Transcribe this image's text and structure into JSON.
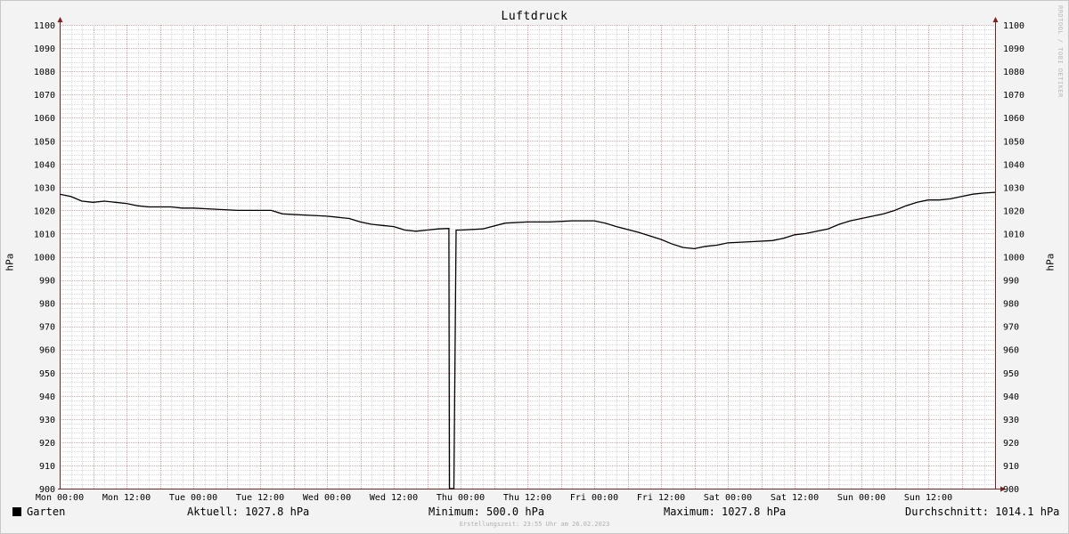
{
  "chart_data": {
    "type": "line",
    "title": "Luftdruck",
    "ylabel": "hPa",
    "ylim": [
      900,
      1100
    ],
    "yticks": [
      900,
      910,
      920,
      930,
      940,
      950,
      960,
      970,
      980,
      990,
      1000,
      1010,
      1020,
      1030,
      1040,
      1050,
      1060,
      1070,
      1080,
      1090,
      1100
    ],
    "xlim": [
      0,
      168
    ],
    "xticks": [
      {
        "x": 0,
        "label": "Mon 00:00"
      },
      {
        "x": 12,
        "label": "Mon 12:00"
      },
      {
        "x": 24,
        "label": "Tue 00:00"
      },
      {
        "x": 36,
        "label": "Tue 12:00"
      },
      {
        "x": 48,
        "label": "Wed 00:00"
      },
      {
        "x": 60,
        "label": "Wed 12:00"
      },
      {
        "x": 72,
        "label": "Thu 00:00"
      },
      {
        "x": 84,
        "label": "Thu 12:00"
      },
      {
        "x": 96,
        "label": "Fri 00:00"
      },
      {
        "x": 108,
        "label": "Fri 12:00"
      },
      {
        "x": 120,
        "label": "Sat 00:00"
      },
      {
        "x": 132,
        "label": "Sat 12:00"
      },
      {
        "x": 144,
        "label": "Sun 00:00"
      },
      {
        "x": 156,
        "label": "Sun 12:00"
      }
    ],
    "grid": true,
    "series": [
      {
        "name": "Garten",
        "color": "#000000",
        "x": [
          0,
          2,
          4,
          6,
          8,
          10,
          12,
          14,
          16,
          18,
          20,
          22,
          24,
          28,
          32,
          36,
          38,
          40,
          44,
          48,
          52,
          54,
          56,
          58,
          60,
          62,
          64,
          66,
          68,
          69.9,
          70,
          70.8,
          71.2,
          71.4,
          72,
          76,
          80,
          84,
          88,
          92,
          96,
          98,
          100,
          104,
          108,
          110,
          112,
          114,
          116,
          118,
          120,
          124,
          128,
          130,
          132,
          134,
          136,
          138,
          140,
          142,
          144,
          146,
          148,
          150,
          152,
          154,
          156,
          158,
          160,
          162,
          164,
          166,
          168
        ],
        "y": [
          1027,
          1026,
          1024,
          1023.5,
          1024,
          1023.5,
          1023,
          1022,
          1021.5,
          1021.5,
          1021.5,
          1021,
          1021,
          1020.5,
          1020,
          1020,
          1020,
          1018.5,
          1018,
          1017.5,
          1016.5,
          1015,
          1014,
          1013.5,
          1013,
          1011.5,
          1011,
          1011.5,
          1012,
          1012.2,
          500,
          500,
          1011.5,
          1011.5,
          1011.5,
          1012,
          1014.5,
          1015,
          1015,
          1015.5,
          1015.5,
          1014.5,
          1013,
          1010.5,
          1007.5,
          1005.5,
          1004,
          1003.5,
          1004.5,
          1005,
          1006,
          1006.5,
          1007,
          1008,
          1009.5,
          1010,
          1011,
          1012,
          1014,
          1015.5,
          1016.5,
          1017.5,
          1018.5,
          1020,
          1022,
          1023.5,
          1024.5,
          1024.5,
          1025,
          1026,
          1027,
          1027.5,
          1027.8
        ]
      }
    ]
  },
  "legend": {
    "series_label": "Garten",
    "aktuell": "Aktuell: 1027.8 hPa",
    "minimum": "Minimum: 500.0 hPa",
    "maximum": "Maximum: 1027.8 hPa",
    "durchschnitt": "Durchschnitt: 1014.1 hPa"
  },
  "watermark": "RRDTOOL / TOBI OETIKER",
  "footer": "Erstellungszeit: 23:55 Uhr am 26.02.2023",
  "colors": {
    "background": "#f3f3f3",
    "plot_background": "#ffffff",
    "minor_grid": "#d8d8d8",
    "major_grid": "#e8a0a0",
    "axis": "#802020",
    "line": "#000000"
  }
}
